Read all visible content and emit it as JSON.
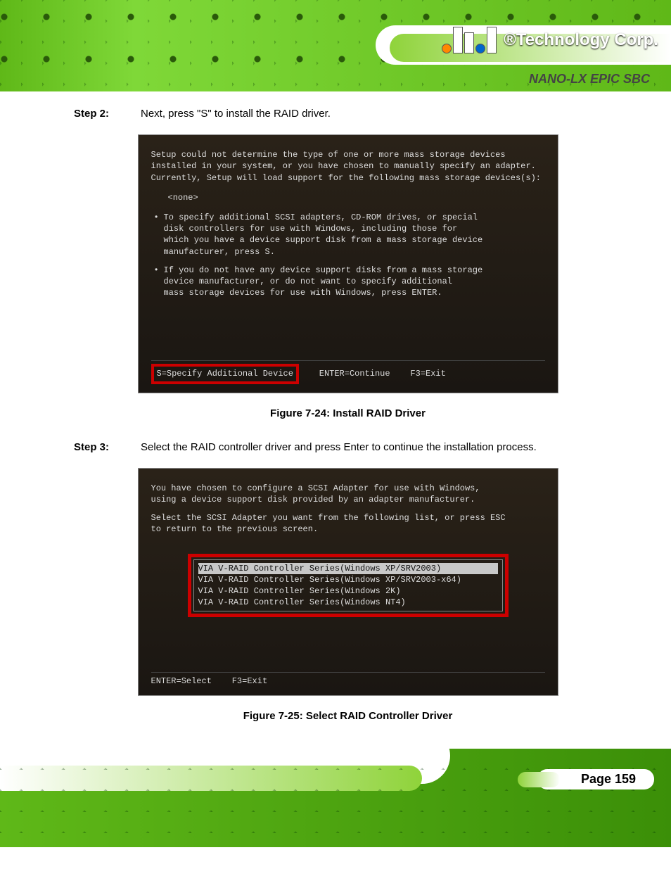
{
  "header": {
    "corp_suffix": "®Technology Corp.",
    "product": "NANO-LX EPIC SBC"
  },
  "step2": {
    "label": "Step 2:",
    "text": "Next, press \"S\" to install the RAID driver."
  },
  "setup1": {
    "l1": "Setup could not determine the type of one or more mass storage devices",
    "l2": "installed in your system, or you have chosen to manually specify an adapter.",
    "l3": "Currently, Setup will load support for the following mass storage devices(s):",
    "none": "<none>",
    "b1a": "To specify additional SCSI adapters, CD-ROM drives, or special",
    "b1b": "disk controllers for use with Windows, including those for",
    "b1c": "which you have a device support disk from a mass storage device",
    "b1d": "manufacturer, press S.",
    "b2a": "If you do not have any device support disks from a mass storage",
    "b2b": "device manufacturer, or do not want to specify additional",
    "b2c": "mass storage devices for use with Windows, press ENTER.",
    "foot_s": "S=Specify Additional Device",
    "foot_enter": "ENTER=Continue",
    "foot_f3": "F3=Exit"
  },
  "fig1": "Figure 7-24: Install RAID Driver",
  "step3": {
    "label": "Step 3:",
    "text": "Select the RAID controller driver and press Enter to continue the installation process."
  },
  "setup2": {
    "l1": "You have chosen to configure a SCSI Adapter for use with Windows,",
    "l2": "using a device support disk provided by an adapter manufacturer.",
    "l3": "Select the SCSI Adapter you want from the following list, or press ESC",
    "l4": "to return to the previous screen.",
    "opt1": "VIA V-RAID Controller Series(Windows XP/SRV2003)",
    "opt2": "VIA V-RAID Controller Series(Windows XP/SRV2003-x64)",
    "opt3": "VIA V-RAID Controller Series(Windows 2K)",
    "opt4": "VIA V-RAID Controller Series(Windows NT4)",
    "foot_enter": "ENTER=Select",
    "foot_f3": "F3=Exit"
  },
  "fig2": "Figure 7-25: Select RAID Controller Driver",
  "page_num": "Page 159"
}
